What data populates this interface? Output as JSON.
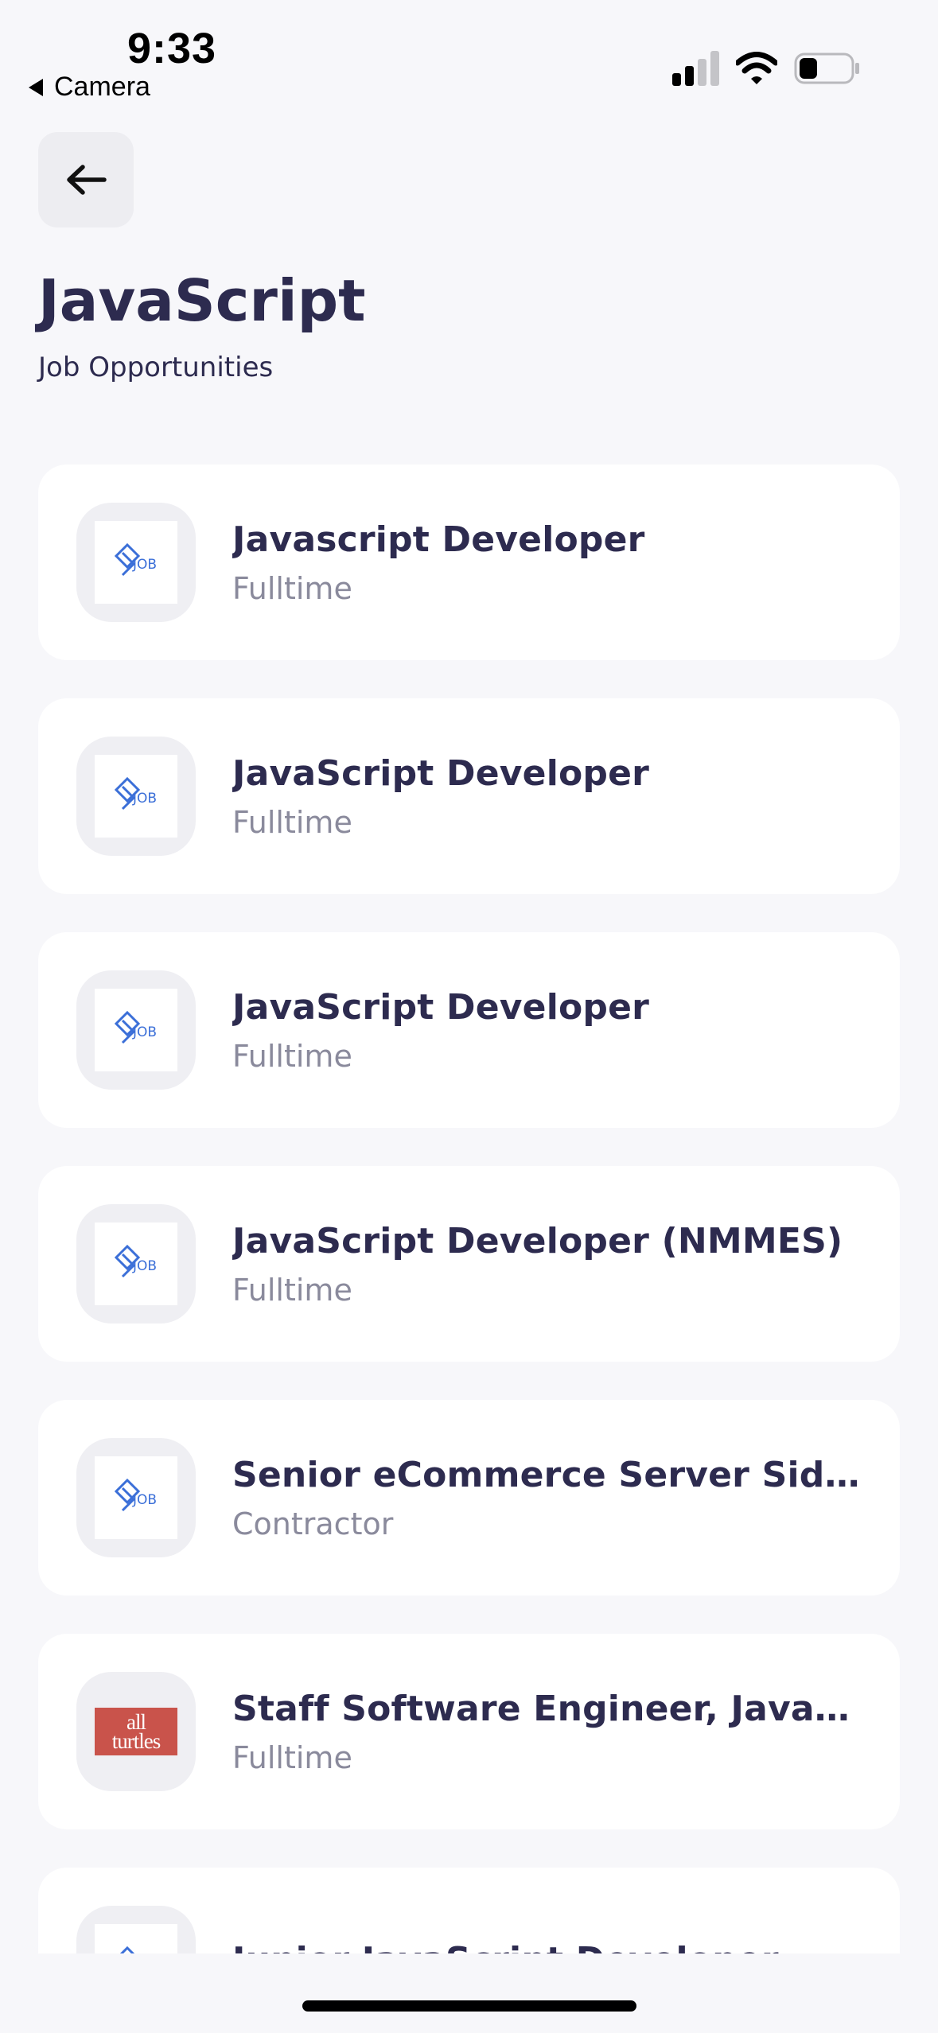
{
  "status_bar": {
    "time": "9:33",
    "back_app_label": "Camera"
  },
  "header": {
    "back_icon": "arrow-left-icon",
    "title": "JavaScript",
    "subtitle": "Job Opportunities"
  },
  "jobs": [
    {
      "title": "Javascript Developer",
      "type": "Fulltime",
      "logo": "job-logo-icon"
    },
    {
      "title": "JavaScript Developer",
      "type": "Fulltime",
      "logo": "job-logo-icon"
    },
    {
      "title": "JavaScript Developer",
      "type": "Fulltime",
      "logo": "job-logo-icon"
    },
    {
      "title": "JavaScript Developer (NMMES)",
      "type": "Fulltime",
      "logo": "job-logo-icon"
    },
    {
      "title": "Senior eCommerce Server Sid…",
      "type": "Contractor",
      "logo": "job-logo-icon"
    },
    {
      "title": "Staff Software Engineer, Javas…",
      "type": "Fulltime",
      "logo": "all-turtles-logo",
      "logo_text": [
        "all",
        "turtles"
      ]
    },
    {
      "title": "Junior JavaScript Developer",
      "type": "",
      "logo": "job-logo-icon"
    }
  ],
  "colors": {
    "background": "#f7f7fa",
    "card": "#ffffff",
    "title_text": "#2d2b4f",
    "secondary_text": "#8a8a9c",
    "job_logo_blue": "#3b6fd8",
    "all_turtles_red": "#c9534b"
  }
}
